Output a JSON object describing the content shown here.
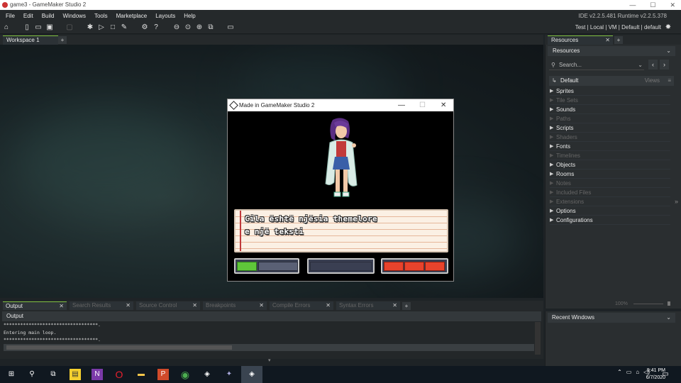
{
  "titlebar": {
    "title": "game3 - GameMaker Studio 2",
    "min": "—",
    "max": "☐",
    "close": "✕"
  },
  "menu": {
    "items": [
      "File",
      "Edit",
      "Build",
      "Windows",
      "Tools",
      "Marketplace",
      "Layouts",
      "Help"
    ],
    "ide_version": "IDE v2.2.5.481  Runtime v2.2.5.378"
  },
  "toolbar": {
    "target": "Test | Local | VM | Default | default"
  },
  "workspace": {
    "tab_label": "Workspace 1",
    "add_tab": "+"
  },
  "game_window": {
    "title": "Made in GameMaker Studio 2",
    "min": "—",
    "max": "☐",
    "close": "✕",
    "dialog_text_line1": "Cila është njësia themelore",
    "dialog_text_line2": "e një teksti"
  },
  "resources": {
    "tab_label": "Resources",
    "header": "Resources",
    "search_placeholder": "Search...",
    "default_label": "Default",
    "views_label": "Views",
    "items": [
      {
        "label": "Sprites",
        "enabled": true
      },
      {
        "label": "Tile Sets",
        "enabled": false
      },
      {
        "label": "Sounds",
        "enabled": true
      },
      {
        "label": "Paths",
        "enabled": false
      },
      {
        "label": "Scripts",
        "enabled": true
      },
      {
        "label": "Shaders",
        "enabled": false
      },
      {
        "label": "Fonts",
        "enabled": true
      },
      {
        "label": "Timelines",
        "enabled": false
      },
      {
        "label": "Objects",
        "enabled": true
      },
      {
        "label": "Rooms",
        "enabled": true
      },
      {
        "label": "Notes",
        "enabled": false
      },
      {
        "label": "Included Files",
        "enabled": false
      },
      {
        "label": "Extensions",
        "enabled": false
      },
      {
        "label": "Options",
        "enabled": true
      },
      {
        "label": "Configurations",
        "enabled": true
      }
    ],
    "zoom": "100%"
  },
  "recent": {
    "header": "Recent Windows"
  },
  "output": {
    "tabs": [
      "Output",
      "Search Results",
      "Source Control",
      "Breakpoints",
      "Compile Errors",
      "Syntax Errors"
    ],
    "header": "Output",
    "lines": [
      "**********************************.",
      "Entering main loop.",
      "**********************************."
    ]
  },
  "taskbar": {
    "time": "9:41 PM",
    "date": "6/7/2020"
  },
  "colors": {
    "accent": "#7fbf3f",
    "bg": "#1e2326",
    "panel": "#2a2e30"
  }
}
